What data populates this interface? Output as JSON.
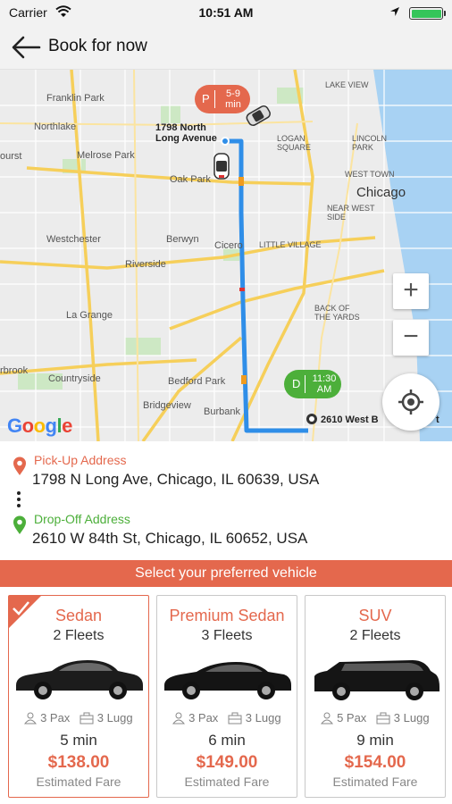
{
  "status": {
    "carrier": "Carrier",
    "time": "10:51 AM"
  },
  "header": {
    "title": "Book for now"
  },
  "map": {
    "pickup_marker": {
      "letter": "P",
      "eta_line1": "5-9",
      "eta_line2": "min"
    },
    "dropoff_marker": {
      "letter": "D",
      "eta_line1": "11:30",
      "eta_line2": "AM"
    },
    "pickup_label_line1": "1798 North",
    "pickup_label_line2": "Long Avenue",
    "dropoff_label": "2610 West B",
    "dropoff_label_tail": "t",
    "zoom_in": "+",
    "zoom_out": "−",
    "google": [
      "G",
      "o",
      "o",
      "g",
      "l",
      "e"
    ],
    "places": {
      "chicago": "Chicago",
      "franklin_park": "Franklin Park",
      "northlake": "Northlake",
      "melrose_park": "Melrose Park",
      "oak_park": "Oak Park",
      "westchester": "Westchester",
      "berwyn": "Berwyn",
      "cicero": "Cicero",
      "little_village": "LITTLE VILLAGE",
      "riverside": "Riverside",
      "la_grange": "La Grange",
      "back_of_yards": "BACK OF\nTHE YARDS",
      "countryside": "Countryside",
      "bedford_park": "Bedford Park",
      "bridgeview": "Bridgeview",
      "burbank": "Burbank",
      "lake_view": "LAKE VIEW",
      "lincoln_park": "LINCOLN\nPARK",
      "logan_square": "LOGAN\nSQUARE",
      "west_town": "WEST TOWN",
      "near_west": "NEAR WEST\nSIDE",
      "bur": "ourst",
      "brook": "rbrook"
    }
  },
  "pickup": {
    "label": "Pick-Up Address",
    "address": "1798 N Long Ave, Chicago, IL 60639, USA"
  },
  "dropoff": {
    "label": "Drop-Off Address",
    "address": "2610 W 84th St, Chicago, IL 60652, USA"
  },
  "select_prompt": "Select your preferred vehicle",
  "vehicles": [
    {
      "name": "Sedan",
      "fleets": "2 Fleets",
      "pax": "3 Pax",
      "lugg": "3 Lugg",
      "eta": "5 min",
      "price": "$138.00",
      "fare_label": "Estimated Fare",
      "selected": true
    },
    {
      "name": "Premium Sedan",
      "fleets": "3 Fleets",
      "pax": "3 Pax",
      "lugg": "3 Lugg",
      "eta": "6 min",
      "price": "$149.00",
      "fare_label": "Estimated Fare",
      "selected": false
    },
    {
      "name": "SUV",
      "fleets": "2 Fleets",
      "pax": "5 Pax",
      "lugg": "3 Lugg",
      "eta": "9 min",
      "price": "$154.00",
      "fare_label": "Estimated Fare",
      "selected": false
    }
  ],
  "colors": {
    "accent": "#e4684d",
    "green": "#4caf3a",
    "route": "#2f8ee8"
  }
}
